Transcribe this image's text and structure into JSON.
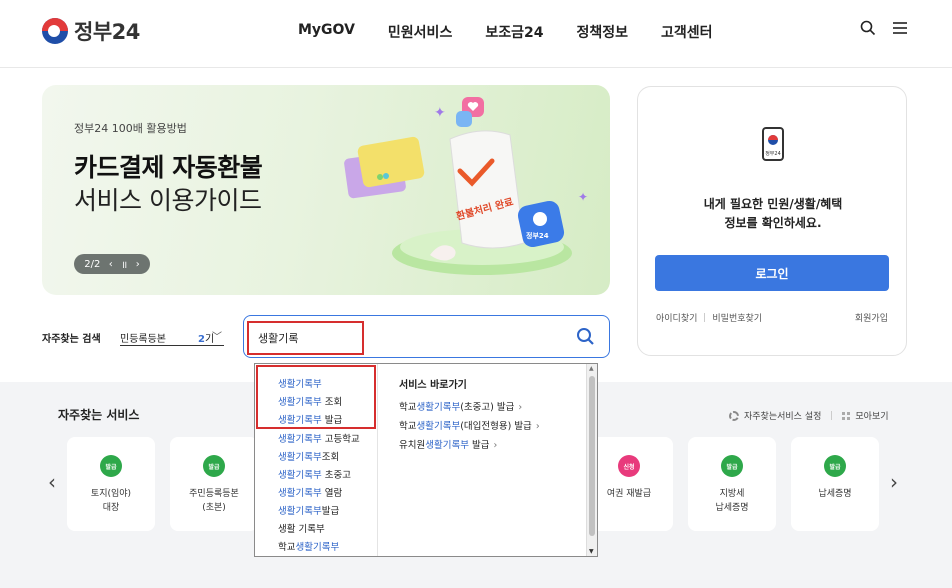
{
  "header": {
    "logo_text": "정부24",
    "nav": [
      "MyGOV",
      "민원서비스",
      "보조금24",
      "정책정보",
      "고객센터"
    ]
  },
  "banner": {
    "subtitle": "정부24 100배 활용방법",
    "title_line1": "카드결제 자동환불",
    "title_line2": "서비스 이용가이드",
    "pager": "2/2",
    "pager_prev": "‹",
    "pager_pause": "॥",
    "pager_next": "›",
    "illustration_text_receipt": "환불처리 완료",
    "illustration_text_app": "정부24",
    "colors": {
      "bg_start": "#f2f7ee",
      "bg_end": "#d6ecc5",
      "accent": "#e23a3a"
    }
  },
  "login": {
    "phone_label": "정부24",
    "message_line1": "내게 필요한 민원/생활/혜택",
    "message_line2": "정보를 확인하세요.",
    "button": "로그인",
    "find_id": "아이디찾기",
    "find_pw": "비밀번호찾기",
    "signup": "회원가입",
    "button_color": "#3a77e0"
  },
  "search": {
    "freq_label": "자주찾는 검색",
    "rotating_keyword": "민등록등본",
    "rotating_count": "2",
    "rotating_suffix": "기",
    "value": "생활기록"
  },
  "autocomplete": {
    "suggestions": [
      {
        "hl": "생활기록부",
        "rest": ""
      },
      {
        "hl": "생활기록부",
        "rest": " 조회"
      },
      {
        "hl": "생활기록부",
        "rest": " 발급"
      },
      {
        "hl": "생활기록부",
        "rest": " 고등학교"
      },
      {
        "hl": "생활기록부",
        "rest": "조회"
      },
      {
        "hl": "생활기록부",
        "rest": " 초중고"
      },
      {
        "hl": "생활기록부",
        "rest": " 열람"
      },
      {
        "hl": "생활기록부",
        "rest": "발급"
      },
      {
        "hl": "",
        "rest": "생활 기록부"
      },
      {
        "pre": "학교",
        "hl": "생활기록부",
        "rest": ""
      }
    ],
    "shortcut_title": "서비스 바로가기",
    "shortcuts": [
      {
        "pre": "학교",
        "hl": "생활기록부",
        "rest": "(초중고) 발급",
        "arrow": "›"
      },
      {
        "pre": "학교",
        "hl": "생활기록부",
        "rest": "(대입전형용) 발급",
        "arrow": "›"
      },
      {
        "pre": "유치원",
        "hl": "생활기록부",
        "rest": " 발급",
        "arrow": "›"
      }
    ]
  },
  "services": {
    "title": "자주찾는 서비스",
    "settings": "자주찾는서비스 설정",
    "collect": "모아보기",
    "prev": "‹",
    "next": "›",
    "cards": [
      {
        "badge": "발급",
        "badge_color": "#2ea84a",
        "line1": "토지(임야)",
        "line2": "대장"
      },
      {
        "badge": "발급",
        "badge_color": "#2ea84a",
        "line1": "주민등록등본",
        "line2": "(초본)"
      },
      {
        "badge": "신청",
        "badge_color": "#e83a7c",
        "line1": "여권 재발급",
        "line2": ""
      },
      {
        "badge": "발급",
        "badge_color": "#2ea84a",
        "line1": "지방세",
        "line2": "납세증명"
      },
      {
        "badge": "발급",
        "badge_color": "#2ea84a",
        "line1": "납세증명",
        "line2": ""
      }
    ]
  }
}
